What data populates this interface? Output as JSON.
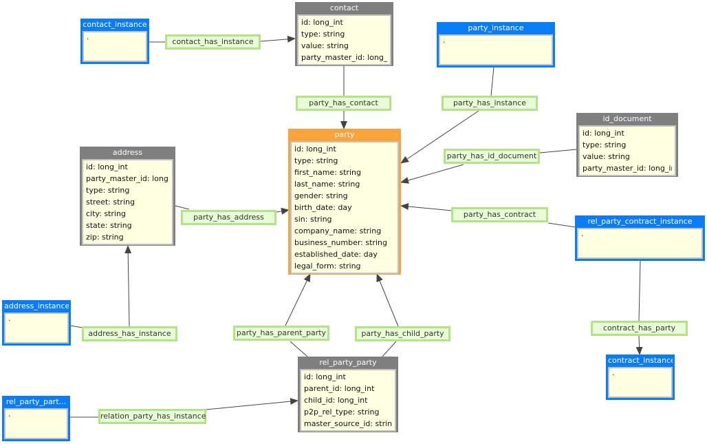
{
  "entities": {
    "contact": {
      "title": "contact",
      "fields": [
        "id: long_int",
        "type: string",
        "value: string",
        "party_master_id: long_int"
      ]
    },
    "party": {
      "title": "party",
      "fields": [
        "id: long_int",
        "type: string",
        "first_name: string",
        "last_name: string",
        "gender: string",
        "birth_date: day",
        "sin: string",
        "company_name: string",
        "business_number: string",
        "established_date: day",
        "legal_form: string"
      ]
    },
    "address": {
      "title": "address",
      "fields": [
        "id: long_int",
        "party_master_id: long...",
        "type: string",
        "street: string",
        "city: string",
        "state: string",
        "zip: string"
      ]
    },
    "id_document": {
      "title": "id_document",
      "fields": [
        "id: long_int",
        "type: string",
        "value: string",
        "party_master_id: long_int"
      ]
    },
    "rel_party_party": {
      "title": "rel_party_party",
      "fields": [
        "id: long_int",
        "parent_id: long_int",
        "child_id: long_int",
        "p2p_rel_type: string",
        "master_source_id: string"
      ]
    }
  },
  "instances": {
    "contact_instance": {
      "title": "contact_instance",
      "placeholder": "."
    },
    "party_instance": {
      "title": "party_instance",
      "placeholder": "."
    },
    "address_instance": {
      "title": "address_instance",
      "placeholder": "."
    },
    "rel_party_party_instance": {
      "title": "rel_party_part...",
      "placeholder": "."
    },
    "rel_party_contract_instance": {
      "title": "rel_party_contract_instance",
      "placeholder": "."
    },
    "contract_instance": {
      "title": "contract_instance",
      "placeholder": "."
    }
  },
  "relations": {
    "contact_has_instance": "contact_has_instance",
    "party_has_contact": "party_has_contact",
    "party_has_instance": "party_has_instance",
    "party_has_id_document": "party_has_id_document",
    "party_has_address": "party_has_address",
    "party_has_contract": "party_has_contract",
    "address_has_instance": "address_has_instance",
    "party_has_parent_party": "party_has_parent_party",
    "party_has_child_party": "party_has_child_party",
    "contract_has_party": "contract_has_party",
    "relation_party_has_instance": "relation_party_has_instance"
  },
  "colors": {
    "entity_header": "#7f7f7f",
    "instance_header": "#0a7cf5",
    "main_entity_header": "#f9a43a",
    "node_body": "#ffffe1",
    "relation_fill": "#e8fcd8",
    "relation_border": "#b4e387",
    "edge": "#444444"
  }
}
